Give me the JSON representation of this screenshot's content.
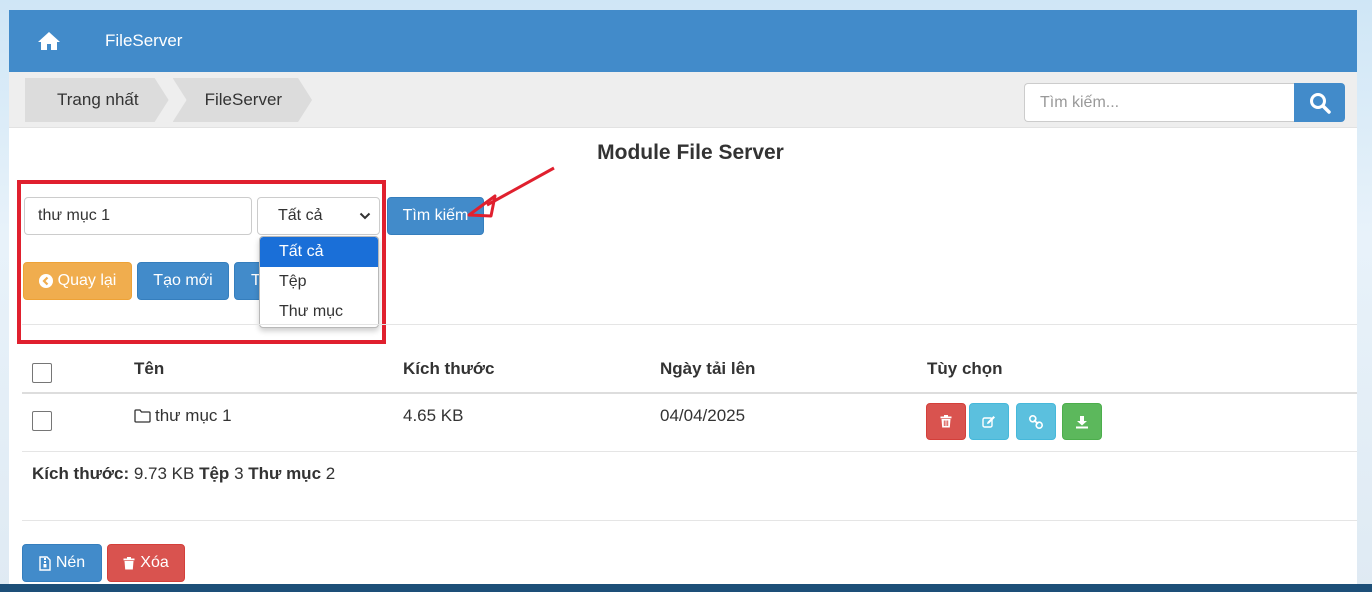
{
  "header": {
    "brand": "FileServer",
    "home_icon": "home-icon"
  },
  "breadcrumb": [
    "Trang nhất",
    "FileServer"
  ],
  "top_search": {
    "placeholder": "Tìm kiếm...",
    "icon": "search-icon"
  },
  "page_title": "Module File Server",
  "filter": {
    "keyword_value": "thư mục 1",
    "type_selected": "Tất cả",
    "type_options": [
      "Tất cả",
      "Tệp",
      "Thư mục"
    ],
    "search_label": "Tìm kiếm"
  },
  "actions": {
    "back_label": "Quay lại",
    "create_label": "Tạo mới",
    "hidden_label": "T"
  },
  "table": {
    "headers": {
      "name": "Tên",
      "size": "Kích thước",
      "date": "Ngày tải lên",
      "options": "Tùy chọn"
    },
    "rows": [
      {
        "name": "thư mục 1",
        "size": "4.65 KB",
        "date": "04/04/2025",
        "icon": "folder-icon"
      }
    ]
  },
  "summary": {
    "size_label": "Kích thước:",
    "size_value": "9.73 KB",
    "files_label": "Tệp",
    "files_value": "3",
    "folders_label": "Thư mục",
    "folders_value": "2"
  },
  "bottom_actions": {
    "compress_label": "Nén",
    "delete_label": "Xóa"
  },
  "colors": {
    "primary": "#428bca",
    "warning": "#f0ad4e",
    "danger": "#d9534f",
    "info": "#5bc0de",
    "success": "#5cb85c",
    "highlight": "#e0202e"
  }
}
